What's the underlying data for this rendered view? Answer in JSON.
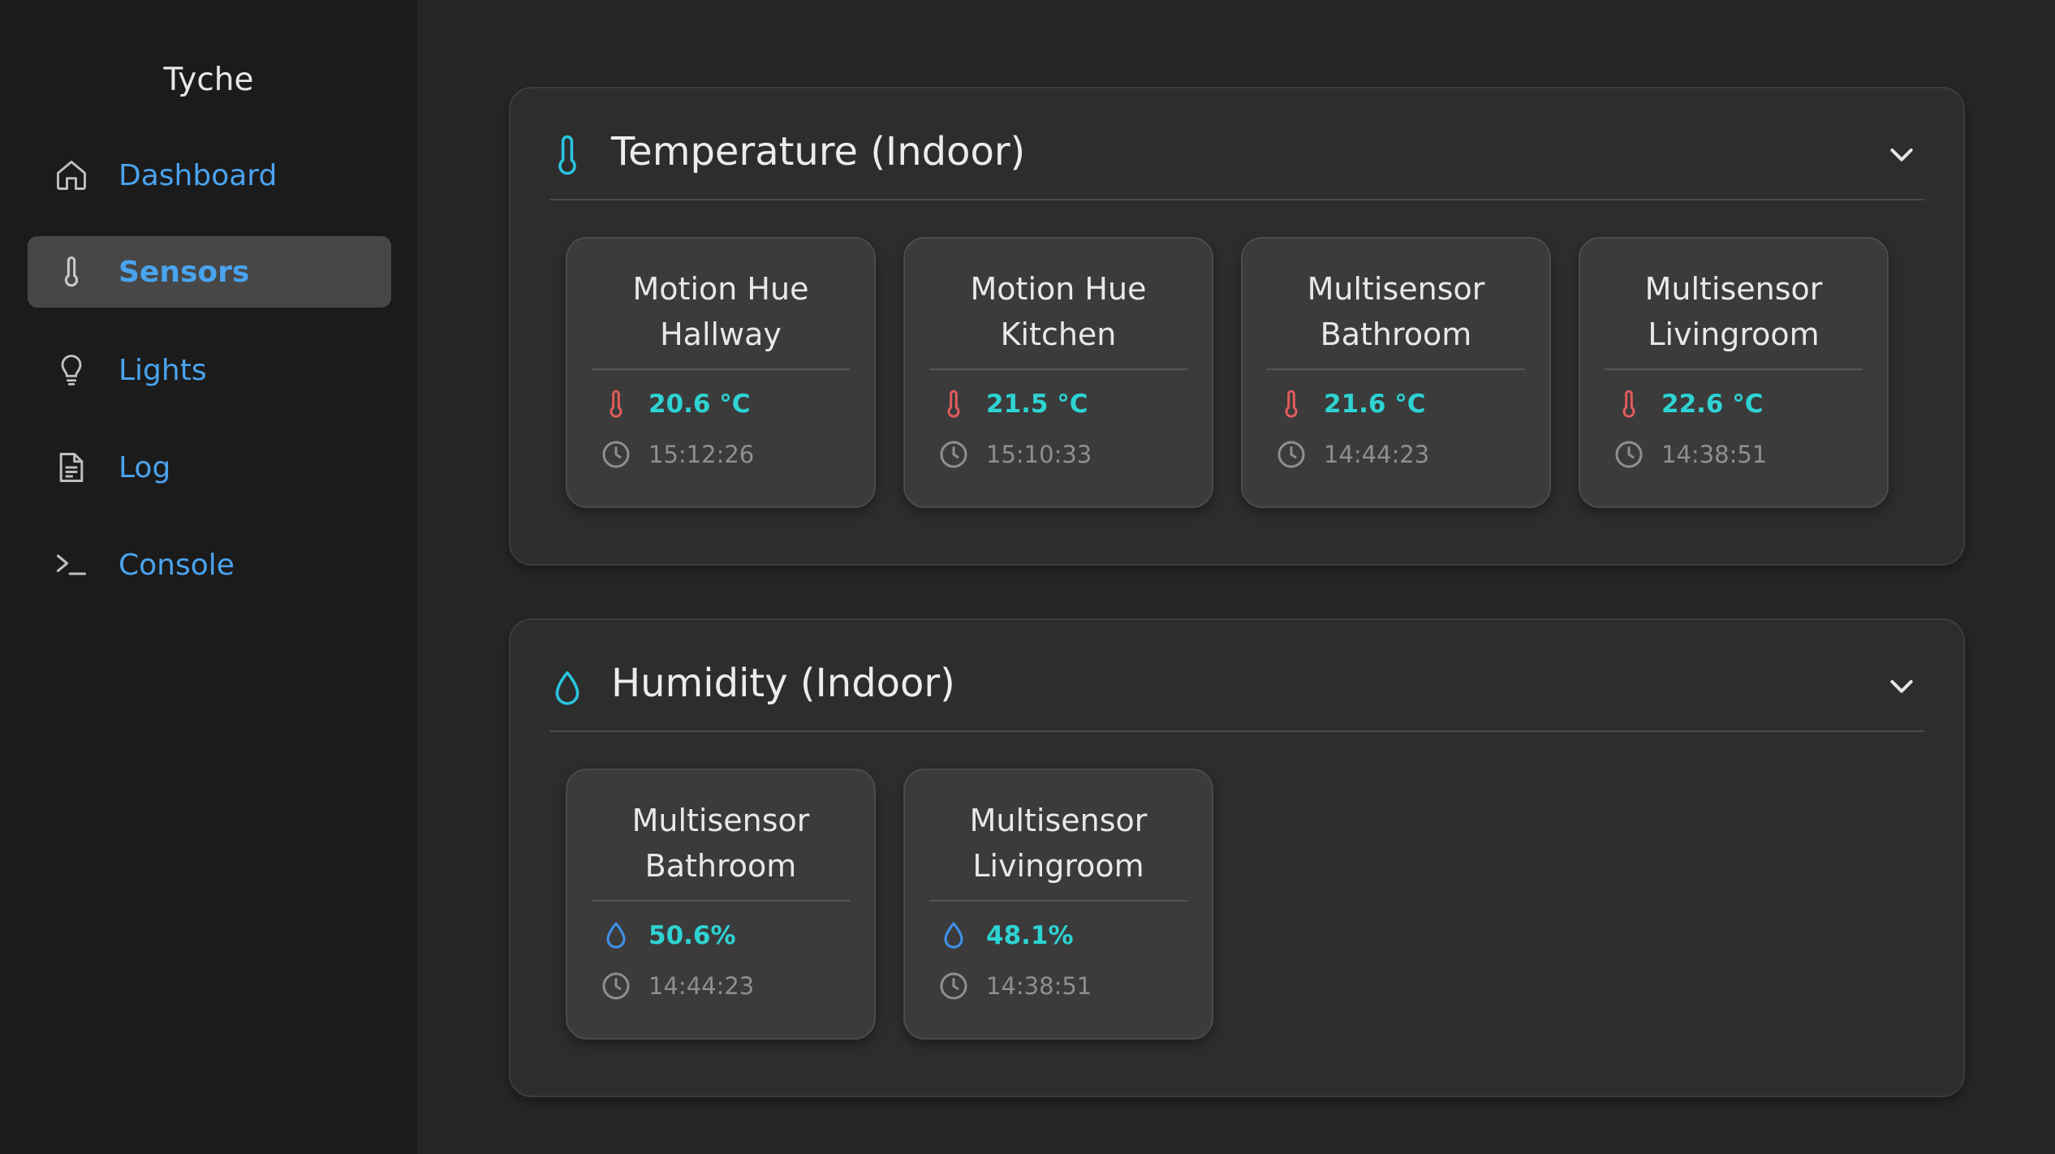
{
  "app": {
    "brand": "Tyche"
  },
  "sidebar": {
    "items": [
      {
        "label": "Dashboard",
        "icon": "home-icon",
        "active": false
      },
      {
        "label": "Sensors",
        "icon": "thermometer-icon",
        "active": true
      },
      {
        "label": "Lights",
        "icon": "lightbulb-icon",
        "active": false
      },
      {
        "label": "Log",
        "icon": "document-icon",
        "active": false
      },
      {
        "label": "Console",
        "icon": "terminal-icon",
        "active": false
      }
    ]
  },
  "sections": [
    {
      "title": "Temperature (Indoor)",
      "icon": "thermometer-icon",
      "sensors": [
        {
          "name": "Motion Hue Hallway",
          "value": "20.6 °C",
          "time": "15:12:26"
        },
        {
          "name": "Motion Hue Kitchen",
          "value": "21.5 °C",
          "time": "15:10:33"
        },
        {
          "name": "Multisensor Bathroom",
          "value": "21.6 °C",
          "time": "14:44:23"
        },
        {
          "name": "Multisensor Livingroom",
          "value": "22.6 °C",
          "time": "14:38:51"
        }
      ]
    },
    {
      "title": "Humidity (Indoor)",
      "icon": "droplet-icon",
      "sensors": [
        {
          "name": "Multisensor Bathroom",
          "value": "50.6%",
          "time": "14:44:23"
        },
        {
          "name": "Multisensor Livingroom",
          "value": "48.1%",
          "time": "14:38:51"
        }
      ]
    }
  ],
  "colors": {
    "accent": "#4aa3ee",
    "value": "#2ed3d3",
    "temperature_icon": "#e25c5c",
    "humidity_icon": "#3f8fe6",
    "section_icon": "#29c4e0"
  }
}
